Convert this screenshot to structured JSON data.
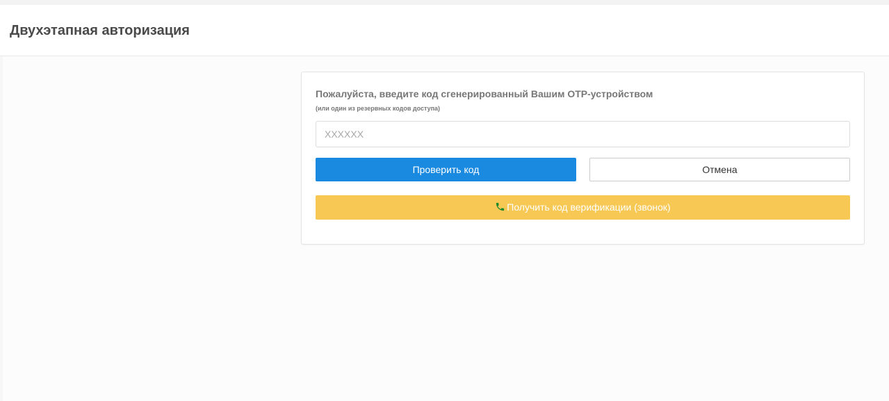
{
  "header": {
    "title": "Двухэтапная авторизация"
  },
  "otp_form": {
    "prompt": "Пожалуйста, введите код сгенерированный Вашим OTP-устройством",
    "hint": "(или один из резервных кодов доступа)",
    "code_input": {
      "placeholder": "XXXXXX",
      "value": ""
    },
    "verify_label": "Проверить код",
    "cancel_label": "Отмена",
    "call_label": "Получить код верификации (звонок)",
    "call_icon": "phone-icon"
  },
  "colors": {
    "primary": "#1a89e0",
    "warning": "#f7c853",
    "phone_icon": "#1e8a2e"
  }
}
